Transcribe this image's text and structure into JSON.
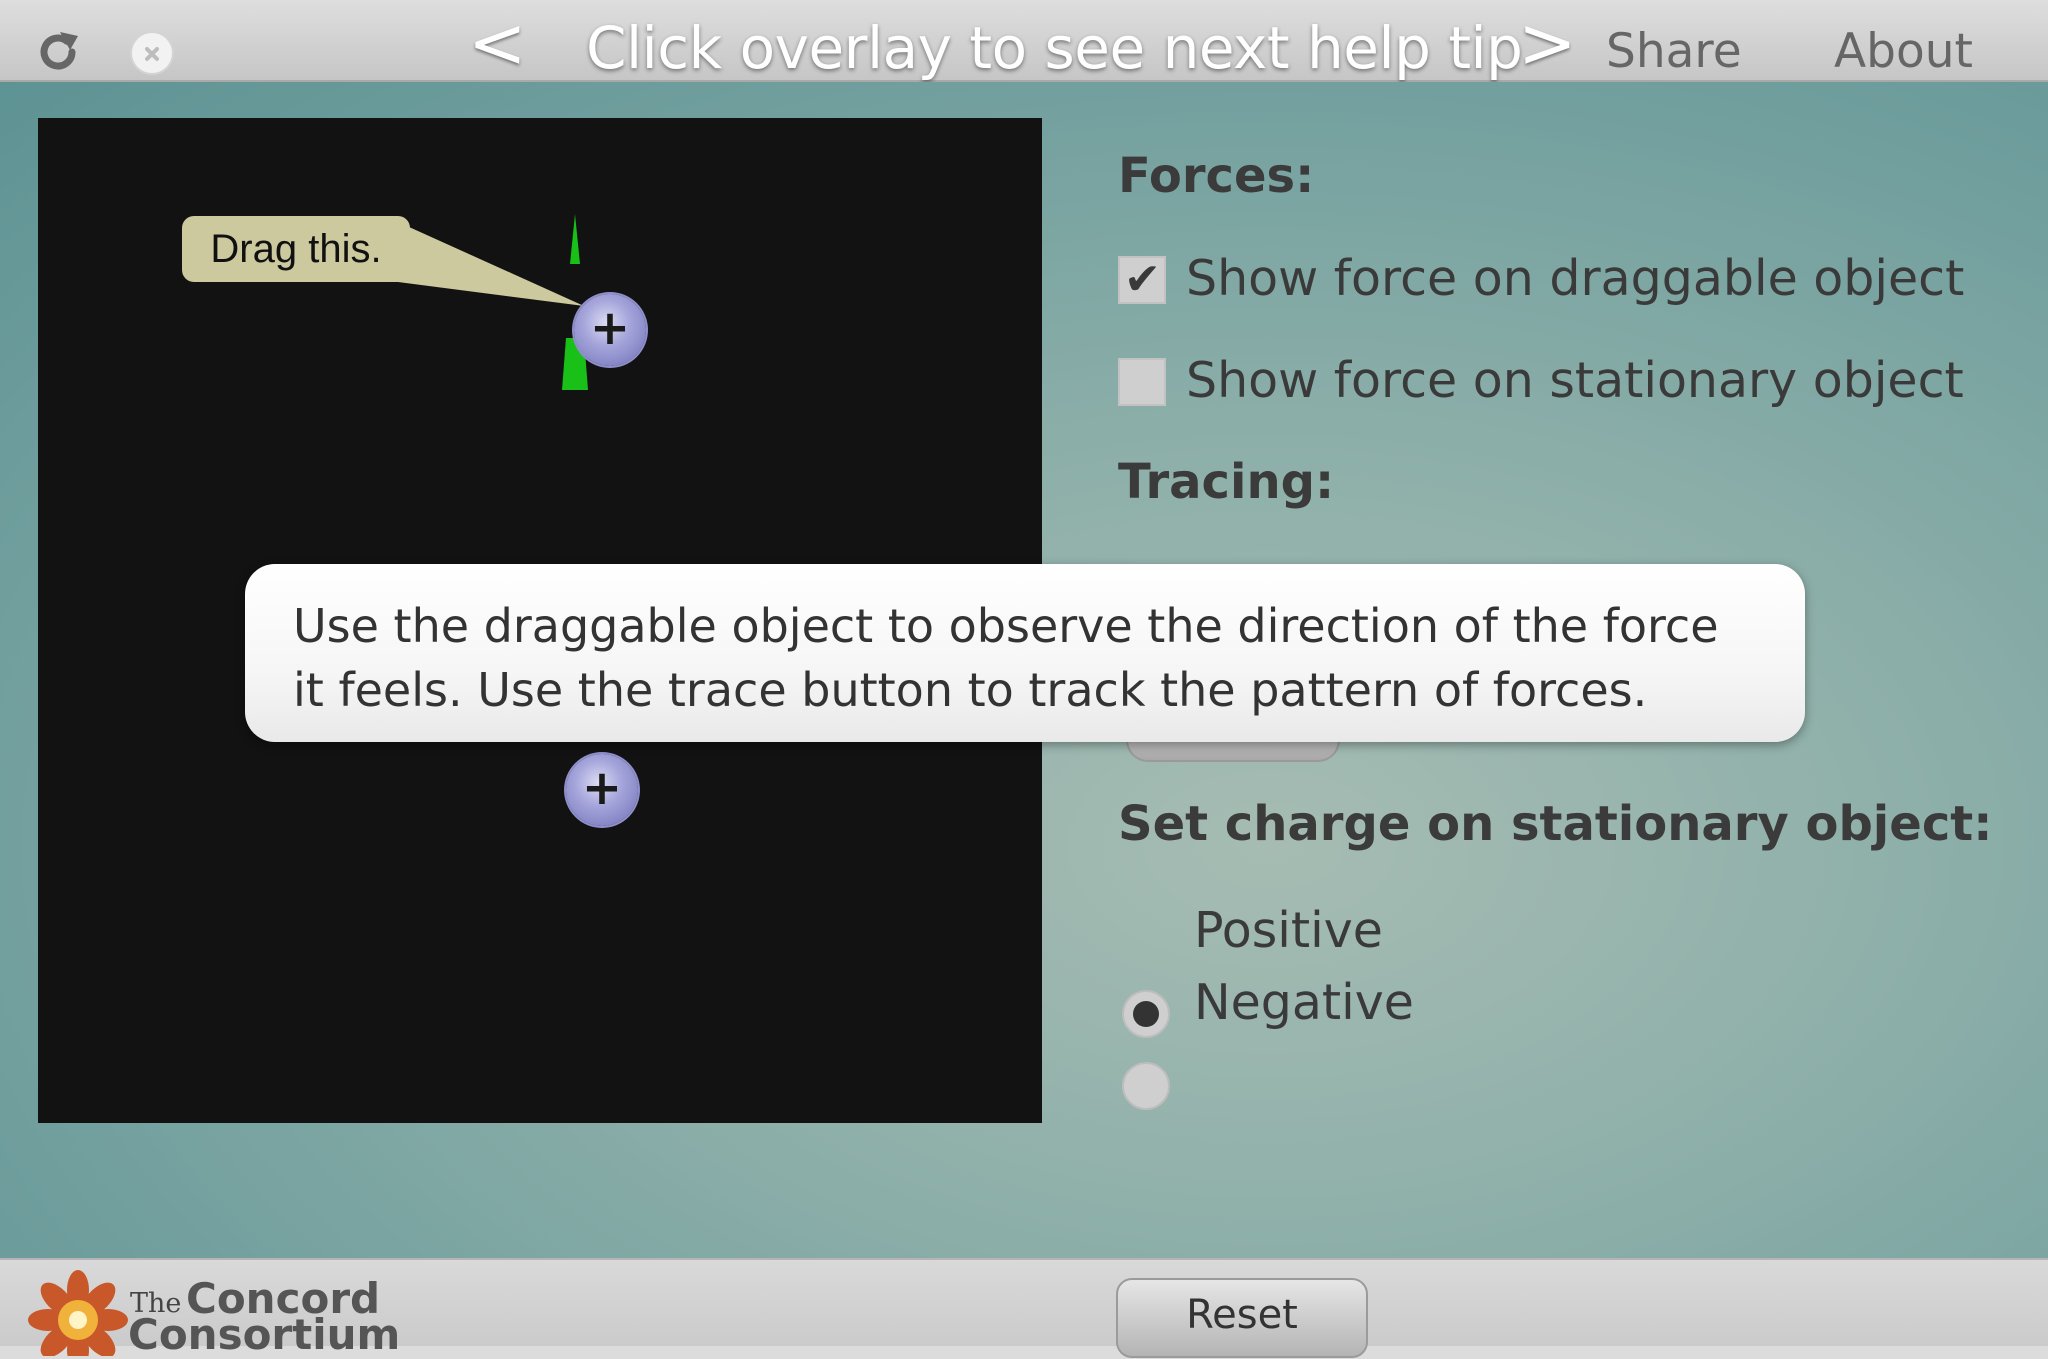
{
  "topbar": {
    "prev_arrow": "<",
    "help_title": "Click overlay to see next help tip",
    "next_arrow": ">",
    "share_label": "Share",
    "about_label": "About"
  },
  "simulation": {
    "drag_tooltip": "Drag this.",
    "draggable_charge_sign": "+",
    "stationary_charge_sign": "+"
  },
  "controls": {
    "forces_heading": "Forces:",
    "show_force_draggable_label": "Show force on draggable object",
    "show_force_draggable_checked": true,
    "show_force_stationary_label": "Show force on stationary object",
    "show_force_stationary_checked": false,
    "tracing_heading": "Tracing:",
    "charge_heading": "Set charge on stationary object:",
    "positive_label": "Positive",
    "negative_label": "Negative",
    "selected_charge": "Positive"
  },
  "help_overlay": {
    "text": "Use the draggable object to observe the direction of the force it feels. Use the trace button to track the pattern of forces."
  },
  "footer": {
    "logo_the": "The",
    "logo_line1": "Concord",
    "logo_line2": "Consortium",
    "reset_label": "Reset"
  },
  "colors": {
    "force_arrow": "#18c018",
    "canvas_bg": "#121212",
    "tooltip_bg": "#cbc99d"
  },
  "icons": [
    "reload-icon",
    "close-icon",
    "checkmark-icon",
    "plus-icon",
    "concord-flower-logo"
  ]
}
